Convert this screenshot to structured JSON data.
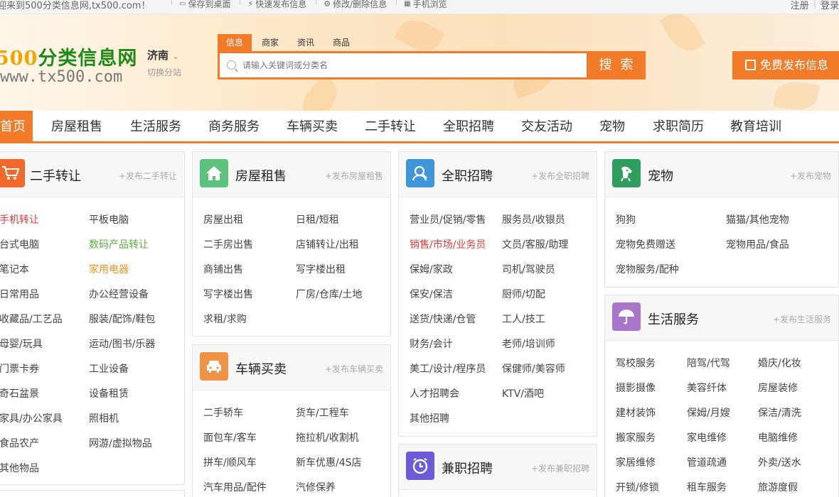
{
  "topbar": {
    "welcome": "迎来到500分类信息网,tx500.com！",
    "save_desktop": "保存到桌面",
    "quick_post": "快速发布信息",
    "modify_delete": "修改/删除信息",
    "mobile": "手机浏览",
    "register": "注册",
    "login": "登录",
    "separator": "|"
  },
  "header": {
    "logo_num": "500",
    "logo_text": "分类信息网",
    "logo_url": "www.tx500.com",
    "city": "济南",
    "switch_city": "切换分站",
    "search_tabs": [
      "信息",
      "商家",
      "资讯",
      "商品"
    ],
    "search_placeholder": "请输入关键词或分类名",
    "search_button": "搜 索",
    "publish_button": "免费发布信息"
  },
  "nav": [
    "首页",
    "房屋租售",
    "生活服务",
    "商务服务",
    "车辆买卖",
    "二手转让",
    "全职招聘",
    "交友活动",
    "宠物",
    "求职简历",
    "教育培训"
  ],
  "cards": {
    "secondhand": {
      "title": "二手转让",
      "post": "+发布二手转让",
      "icon_color": "#f26a2b",
      "links": [
        "手机转让",
        "平板电脑",
        "台式电脑",
        "数码产品转让",
        "笔记本",
        "家用电器",
        "日常用品",
        "办公经营设备",
        "收藏品/工艺品",
        "服装/配饰/鞋包",
        "母婴/玩具",
        "运动/图书/乐器",
        "门票卡券",
        "工业设备",
        "奇石盆景",
        "设备租赁",
        "家具/办公家具",
        "照相机",
        "食品农产",
        "网游/虚拟物品",
        "其他物品"
      ]
    },
    "house": {
      "title": "房屋租售",
      "post": "+发布房屋租售",
      "icon_color": "#5cc17a",
      "links": [
        "房屋出租",
        "日租/短租",
        "二手房出售",
        "店铺转让/出租",
        "商铺出售",
        "写字楼出租",
        "写字楼出售",
        "厂房/仓库/土地",
        "求租/求购"
      ]
    },
    "vehicle": {
      "title": "车辆买卖",
      "post": "+发布车辆买卖",
      "icon_color": "#ef9447",
      "links": [
        "二手轿车",
        "货车/工程车",
        "面包车/客车",
        "拖拉机/收割机",
        "拼车/顺风车",
        "新车优惠/4S店",
        "汽车用品/配件",
        "汽修保养"
      ]
    },
    "fulltime": {
      "title": "全职招聘",
      "post": "+发布全职招聘",
      "icon_color": "#3f97d9",
      "links": [
        "营业员/促销/零售",
        "服务员/收银员",
        "销售/市场/业务员",
        "文员/客服/助理",
        "保姆/家政",
        "司机/驾驶员",
        "保安/保洁",
        "厨师/切配",
        "送货/快递/仓管",
        "工人/技工",
        "财务/会计",
        "老师/培训师",
        "美工/设计/程序员",
        "保健师/美容师",
        "人才招聘会",
        "KTV/酒吧",
        "其他招聘"
      ]
    },
    "parttime": {
      "title": "兼职招聘",
      "post": "+发布兼职招聘",
      "icon_color": "#6b5bd6"
    },
    "pet": {
      "title": "宠物",
      "post": "+发布宠物",
      "icon_color": "#2f9e5e",
      "links": [
        "狗狗",
        "猫猫/其他宠物",
        "宠物免费赠送",
        "宠物用品/食品",
        "宠物服务/配种"
      ]
    },
    "life": {
      "title": "生活服务",
      "post": "+发布生活服务",
      "icon_color": "#a876c9",
      "links": [
        "驾校服务",
        "陪驾/代驾",
        "婚庆/化妆",
        "摄影摄像",
        "美容纤体",
        "房屋装修",
        "建材装饰",
        "保姆/月嫂",
        "保洁/清洗",
        "搬家服务",
        "家电维修",
        "电脑维修",
        "家居维修",
        "管道疏通",
        "外卖/送水",
        "开锁/修锁",
        "租车服务",
        "旅游度假"
      ]
    }
  },
  "colors": {
    "accent": "#f27b2a",
    "highlight_red": "#e4393c",
    "highlight_green": "#5cad3c",
    "highlight_orange": "#f0931e"
  }
}
